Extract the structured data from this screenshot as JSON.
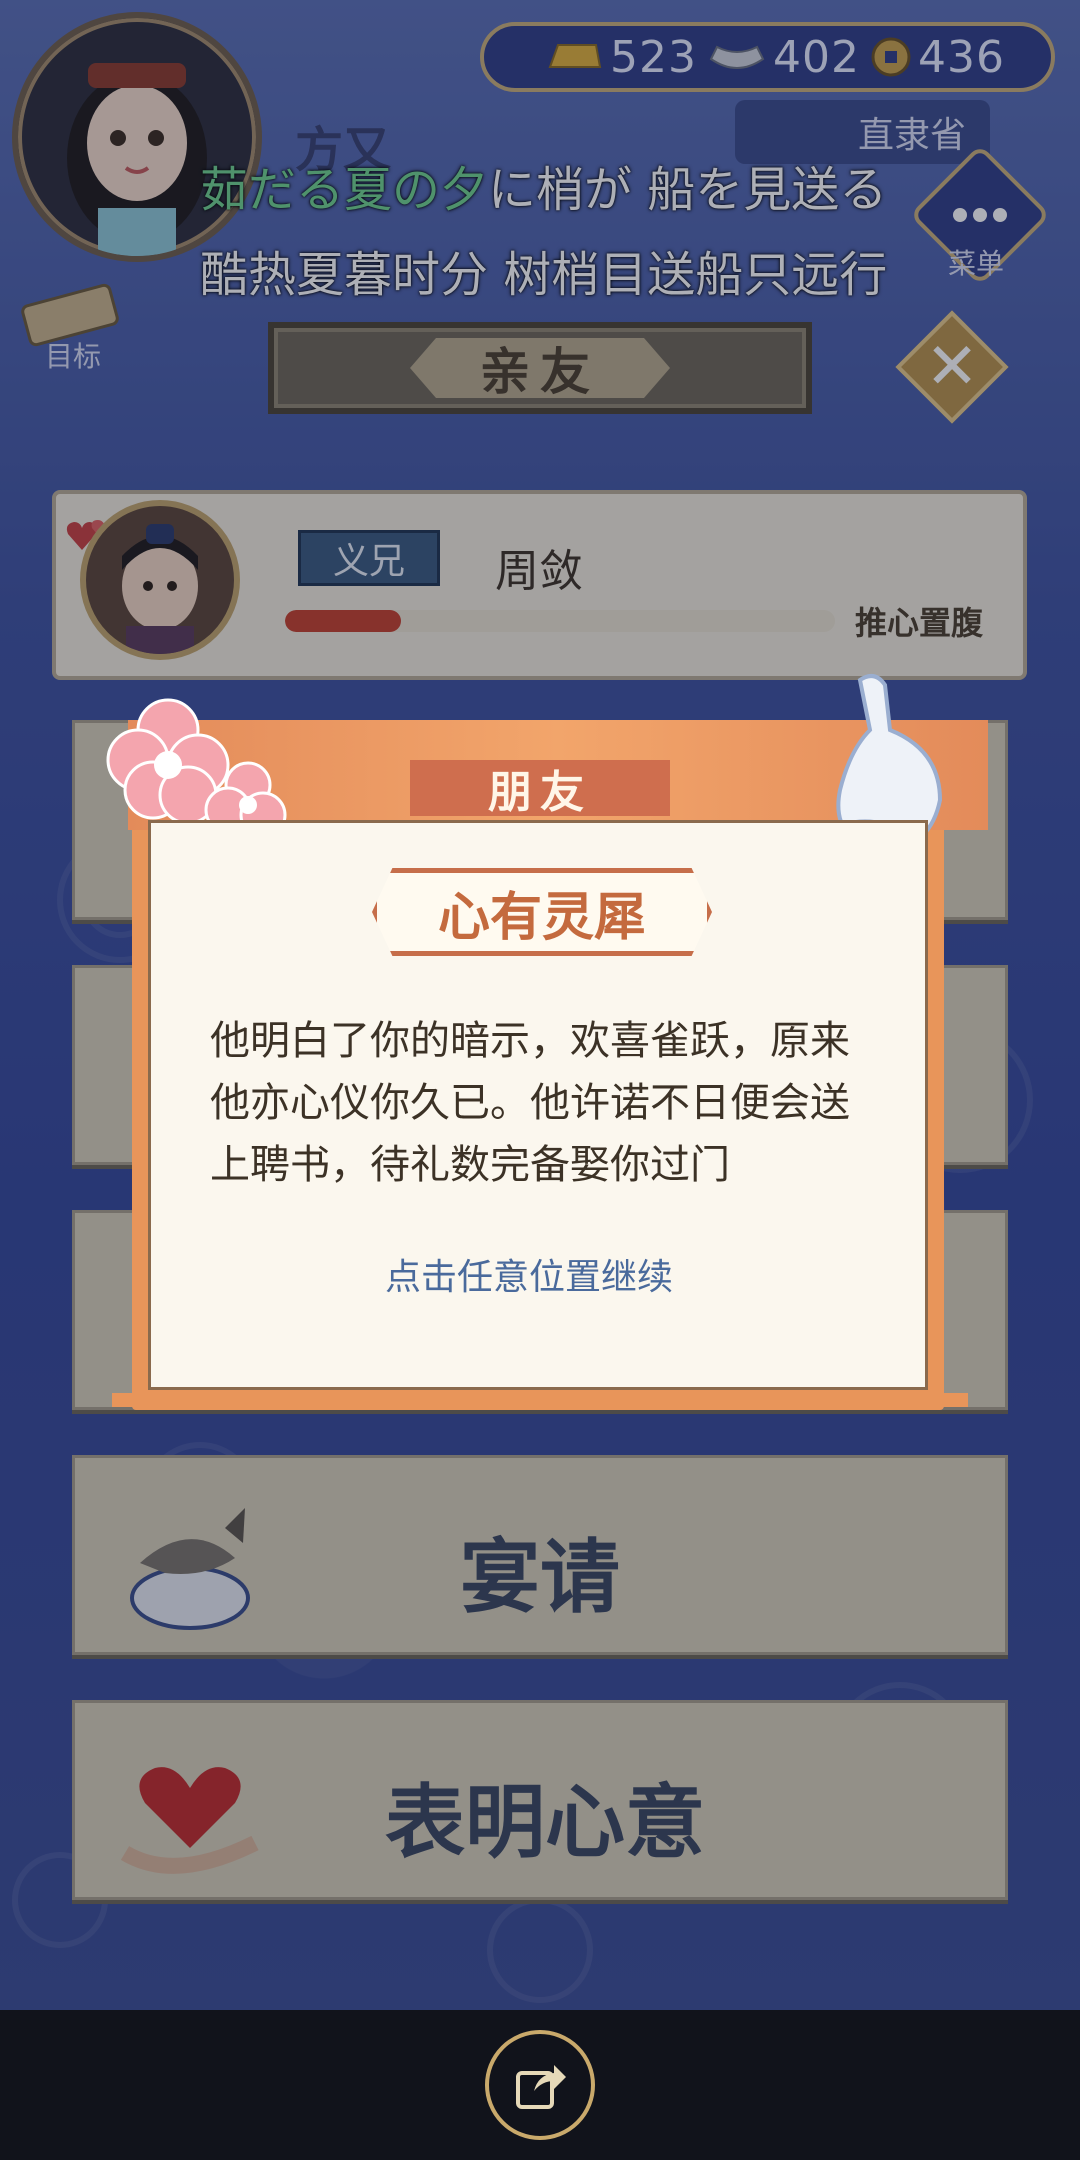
{
  "resources": {
    "gold": "523",
    "silver": "402",
    "coins": "436"
  },
  "top": {
    "province": "直隶省",
    "menu_label": "菜单",
    "target_label": "目标",
    "player_name_partial": "方又"
  },
  "subtitle": {
    "ja_highlight": "茹だる夏の夕",
    "ja_rest": "に梢が 船を見送る",
    "zh": "酷热夏暮时分 树梢目送船只远行"
  },
  "screen_title": "亲友",
  "friend": {
    "relation": "义兄",
    "name": "周敛",
    "bond_label": "推心置腹",
    "bond_level": 0.21
  },
  "options": {
    "banquet": "宴请",
    "confess": "表明心意"
  },
  "dialog": {
    "banner": "朋友",
    "title": "心有灵犀",
    "body": "他明白了你的暗示，欢喜雀跃，原来他亦心仪你久已。他许诺不日便会送上聘书，待礼数完备娶你过门",
    "hint": "点击任意位置继续"
  }
}
